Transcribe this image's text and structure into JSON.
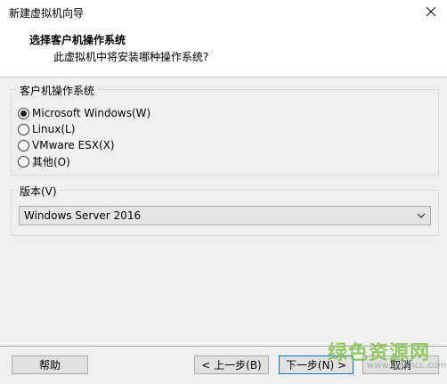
{
  "window": {
    "title": "新建虚拟机向导"
  },
  "header": {
    "title": "选择客户机操作系统",
    "subtitle": "此虚拟机中将安装哪种操作系统?"
  },
  "os_group": {
    "legend": "客户机操作系统",
    "options": [
      {
        "label": "Microsoft Windows(W)",
        "selected": true
      },
      {
        "label": "Linux(L)",
        "selected": false
      },
      {
        "label": "VMware ESX(X)",
        "selected": false
      },
      {
        "label": "其他(O)",
        "selected": false
      }
    ]
  },
  "version_group": {
    "legend": "版本(V)",
    "selected": "Windows Server 2016"
  },
  "buttons": {
    "help": "帮助",
    "back": "< 上一步(B)",
    "next": "下一步(N) >",
    "cancel": "取消"
  },
  "watermark": {
    "text": "绿色资源网",
    "url": "www.downcc.com"
  },
  "colors": {
    "accent": "#0078d7",
    "watermark": "#78be3c"
  }
}
